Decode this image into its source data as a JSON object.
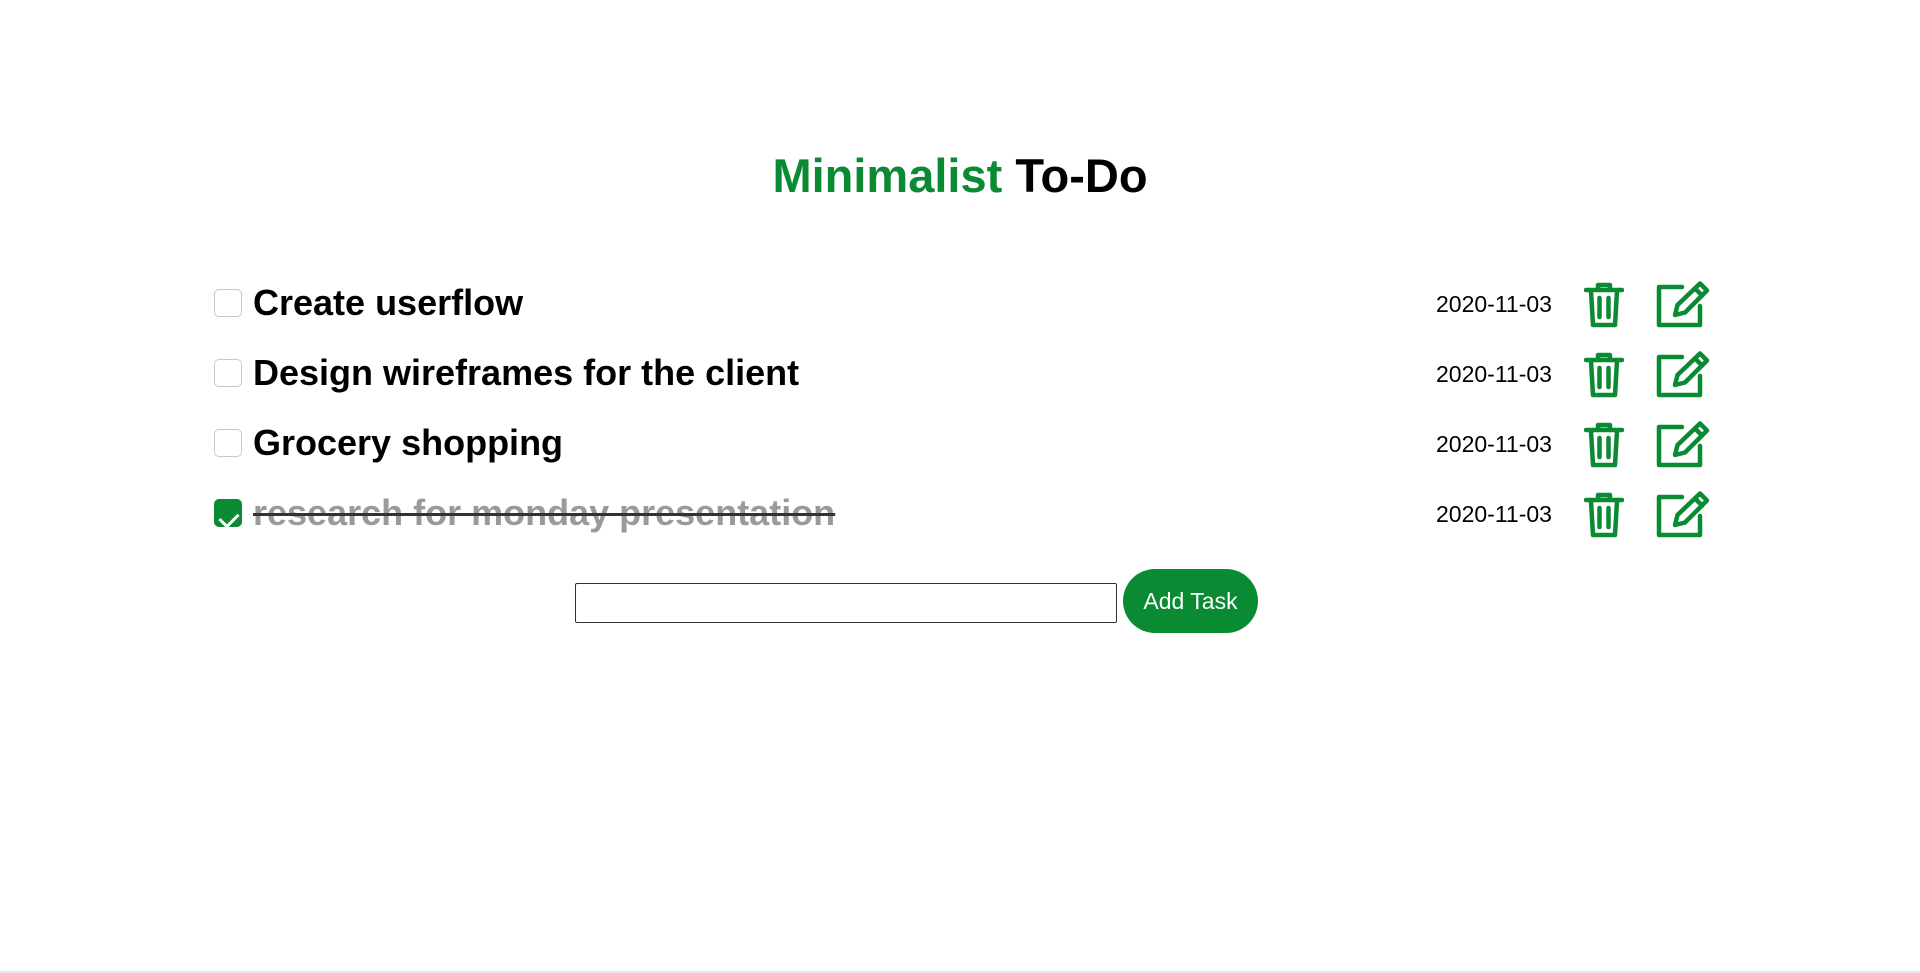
{
  "header": {
    "title_accent": "Minimalist",
    "title_rest": "To-Do"
  },
  "tasks": [
    {
      "text": "Create userflow",
      "date": "2020-11-03",
      "done": false
    },
    {
      "text": "Design wireframes for the client",
      "date": "2020-11-03",
      "done": false
    },
    {
      "text": "Grocery shopping",
      "date": "2020-11-03",
      "done": false
    },
    {
      "text": "research for monday presentation",
      "date": "2020-11-03",
      "done": true
    }
  ],
  "icons": {
    "delete": "trash-icon",
    "edit": "edit-icon"
  },
  "add_form": {
    "input_value": "",
    "input_placeholder": "",
    "button_label": "Add Task"
  },
  "colors": {
    "accent": "#0a8a32",
    "text": "#000000",
    "done_text": "#9a9a9a"
  }
}
